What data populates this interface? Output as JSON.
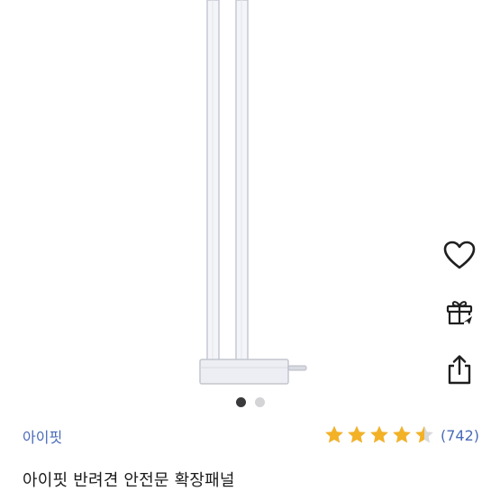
{
  "product": {
    "image": {
      "alt_icon": "pet-gate-extension-panel-image"
    },
    "carousel": {
      "total": 2,
      "current": 1
    },
    "actions": [
      {
        "name": "wishlist-button",
        "icon": "heart-icon"
      },
      {
        "name": "gift-button",
        "icon": "gift-icon"
      },
      {
        "name": "share-button",
        "icon": "share-icon"
      }
    ],
    "brand": "아이핏",
    "rating": {
      "value": 4.5,
      "max": 5,
      "review_count": "(742)"
    },
    "title": "아이핏 반려견 안전문 확장패널"
  },
  "colors": {
    "brand_link": "#4a6bb8",
    "star": "#f3b126",
    "star_empty": "#d9d9d9"
  }
}
